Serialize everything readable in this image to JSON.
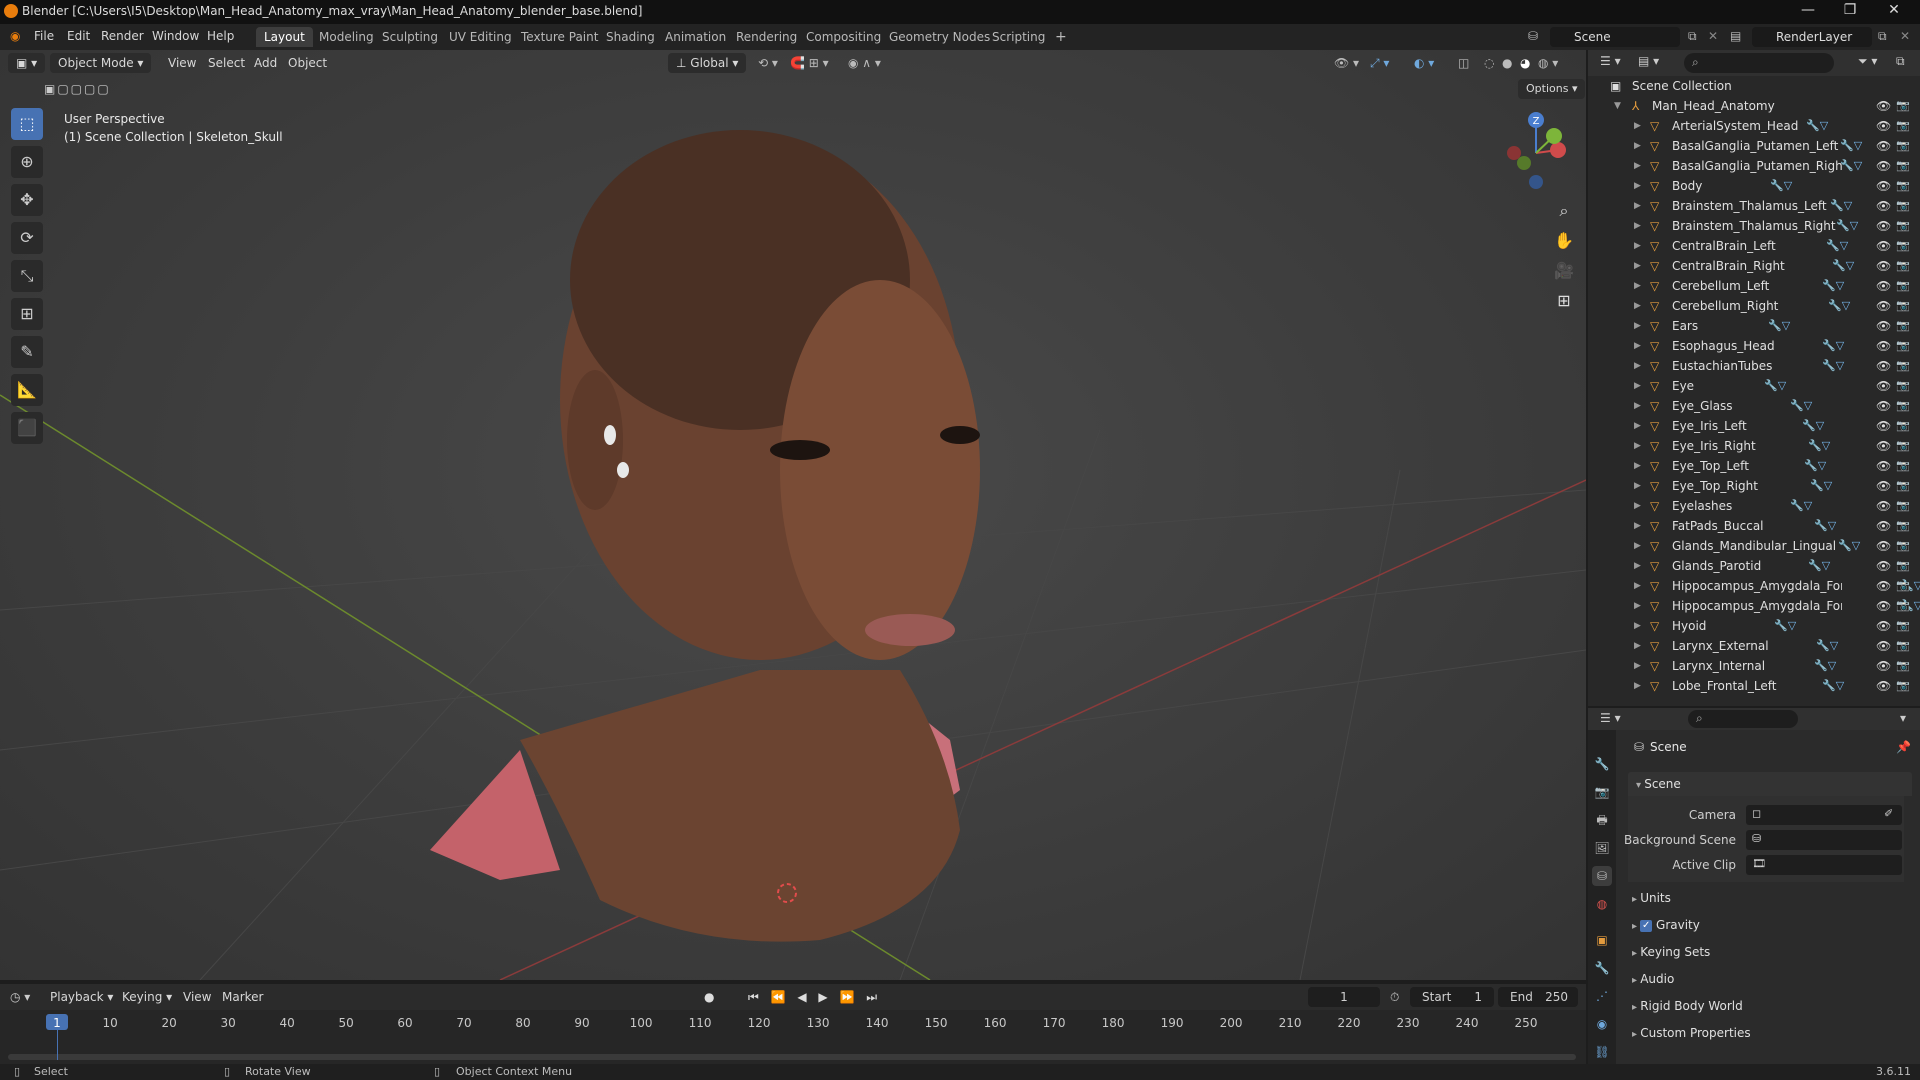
{
  "window": {
    "title": "Blender [C:\\Users\\I5\\Desktop\\Man_Head_Anatomy_max_vray\\Man_Head_Anatomy_blender_base.blend]",
    "minimize": "—",
    "maximize": "❐",
    "close": "✕"
  },
  "menu": [
    "File",
    "Edit",
    "Render",
    "Window",
    "Help"
  ],
  "workspaces": [
    {
      "label": "Layout",
      "active": true
    },
    {
      "label": "Modeling"
    },
    {
      "label": "Sculpting"
    },
    {
      "label": "UV Editing"
    },
    {
      "label": "Texture Paint"
    },
    {
      "label": "Shading"
    },
    {
      "label": "Animation"
    },
    {
      "label": "Rendering"
    },
    {
      "label": "Compositing"
    },
    {
      "label": "Geometry Nodes"
    },
    {
      "label": "Scripting"
    }
  ],
  "add_workspace": "+",
  "scene_field": "Scene",
  "renderlayer_field": "RenderLayer",
  "viewport": {
    "mode": "Object Mode",
    "menus": [
      "View",
      "Select",
      "Add",
      "Object"
    ],
    "transform_orientation": "Global",
    "options": "Options",
    "perspective": "User Perspective",
    "collection_info": "(1) Scene Collection | Skeleton_Skull",
    "gizmo": {
      "z": "Z",
      "y": "Y",
      "x": "X"
    }
  },
  "tools": [
    "select-box",
    "cursor",
    "move",
    "rotate",
    "scale",
    "transform",
    "annotate",
    "measure",
    "add-cube"
  ],
  "outliner": {
    "root": "Scene Collection",
    "collection": "Man_Head_Anatomy",
    "items": [
      "ArterialSystem_Head",
      "BasalGanglia_Putamen_Left",
      "BasalGanglia_Putamen_Right",
      "Body",
      "Brainstem_Thalamus_Left",
      "Brainstem_Thalamus_Right",
      "CentralBrain_Left",
      "CentralBrain_Right",
      "Cerebellum_Left",
      "Cerebellum_Right",
      "Ears",
      "Esophagus_Head",
      "EustachianTubes",
      "Eye",
      "Eye_Glass",
      "Eye_Iris_Left",
      "Eye_Iris_Right",
      "Eye_Top_Left",
      "Eye_Top_Right",
      "Eyelashes",
      "FatPads_Buccal",
      "Glands_Mandibular_Lingual",
      "Glands_Parotid",
      "Hippocampus_Amygdala_Fornix_Le",
      "Hippocampus_Amygdala_Fornix_Ric",
      "Hyoid",
      "Larynx_External",
      "Larynx_Internal",
      "Lobe_Frontal_Left"
    ]
  },
  "properties": {
    "context": "Scene",
    "section": "Scene",
    "camera_label": "Camera",
    "background_label": "Background Scene",
    "clip_label": "Active Clip",
    "subsections": [
      "Units",
      "Gravity",
      "Keying Sets",
      "Audio",
      "Rigid Body World",
      "Custom Properties"
    ]
  },
  "timeline": {
    "menus": [
      "Playback",
      "Keying",
      "View",
      "Marker"
    ],
    "current_frame": "1",
    "start_label": "Start",
    "start": "1",
    "end_label": "End",
    "end": "250",
    "ticks": [
      "1",
      "10",
      "20",
      "30",
      "40",
      "50",
      "60",
      "70",
      "80",
      "90",
      "100",
      "110",
      "120",
      "130",
      "140",
      "150",
      "160",
      "170",
      "180",
      "190",
      "200",
      "210",
      "220",
      "230",
      "240",
      "250"
    ]
  },
  "status": {
    "select": "Select",
    "rotate": "Rotate View",
    "context_menu": "Object Context Menu",
    "version": "3.6.11"
  }
}
